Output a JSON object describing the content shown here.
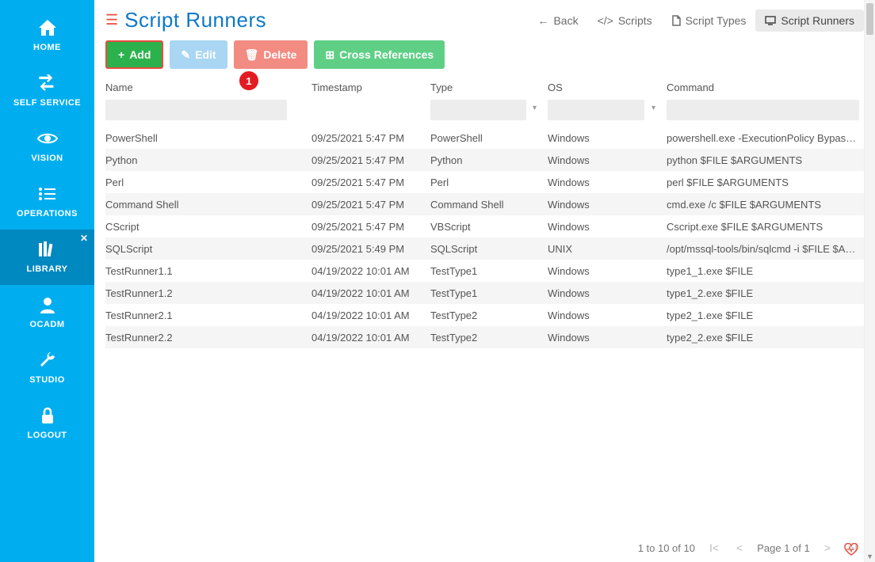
{
  "sidebar": {
    "items": [
      {
        "key": "home",
        "label": "HOME"
      },
      {
        "key": "self_service",
        "label": "SELF SERVICE"
      },
      {
        "key": "vision",
        "label": "VISION"
      },
      {
        "key": "operations",
        "label": "OPERATIONS"
      },
      {
        "key": "library",
        "label": "LIBRARY"
      },
      {
        "key": "ocadm",
        "label": "OCADM"
      },
      {
        "key": "studio",
        "label": "STUDIO"
      },
      {
        "key": "logout",
        "label": "LOGOUT"
      }
    ]
  },
  "header": {
    "title": "Script Runners",
    "nav": {
      "back": "Back",
      "scripts": "Scripts",
      "script_types": "Script Types",
      "script_runners": "Script Runners"
    }
  },
  "toolbar": {
    "add": "Add",
    "edit": "Edit",
    "delete": "Delete",
    "cross": "Cross References"
  },
  "badge": "1",
  "columns": {
    "name": "Name",
    "timestamp": "Timestamp",
    "type": "Type",
    "os": "OS",
    "command": "Command"
  },
  "rows": [
    {
      "name": "PowerShell",
      "timestamp": "09/25/2021 5:47 PM",
      "type": "PowerShell",
      "os": "Windows",
      "command": "powershell.exe -ExecutionPolicy Bypass -F..."
    },
    {
      "name": "Python",
      "timestamp": "09/25/2021 5:47 PM",
      "type": "Python",
      "os": "Windows",
      "command": "python $FILE $ARGUMENTS"
    },
    {
      "name": "Perl",
      "timestamp": "09/25/2021 5:47 PM",
      "type": "Perl",
      "os": "Windows",
      "command": "perl $FILE $ARGUMENTS"
    },
    {
      "name": "Command Shell",
      "timestamp": "09/25/2021 5:47 PM",
      "type": "Command Shell",
      "os": "Windows",
      "command": "cmd.exe /c $FILE $ARGUMENTS"
    },
    {
      "name": "CScript",
      "timestamp": "09/25/2021 5:47 PM",
      "type": "VBScript",
      "os": "Windows",
      "command": "Cscript.exe $FILE $ARGUMENTS"
    },
    {
      "name": "SQLScript",
      "timestamp": "09/25/2021 5:49 PM",
      "type": "SQLScript",
      "os": "UNIX",
      "command": "/opt/mssql-tools/bin/sqlcmd -i $FILE $AR..."
    },
    {
      "name": "TestRunner1.1",
      "timestamp": "04/19/2022 10:01 AM",
      "type": "TestType1",
      "os": "Windows",
      "command": "type1_1.exe $FILE"
    },
    {
      "name": "TestRunner1.2",
      "timestamp": "04/19/2022 10:01 AM",
      "type": "TestType1",
      "os": "Windows",
      "command": "type1_2.exe $FILE"
    },
    {
      "name": "TestRunner2.1",
      "timestamp": "04/19/2022 10:01 AM",
      "type": "TestType2",
      "os": "Windows",
      "command": "type2_1.exe $FILE"
    },
    {
      "name": "TestRunner2.2",
      "timestamp": "04/19/2022 10:01 AM",
      "type": "TestType2",
      "os": "Windows",
      "command": "type2_2.exe $FILE"
    }
  ],
  "footer": {
    "range": "1 to 10 of 10",
    "page": "Page 1 of 1"
  }
}
